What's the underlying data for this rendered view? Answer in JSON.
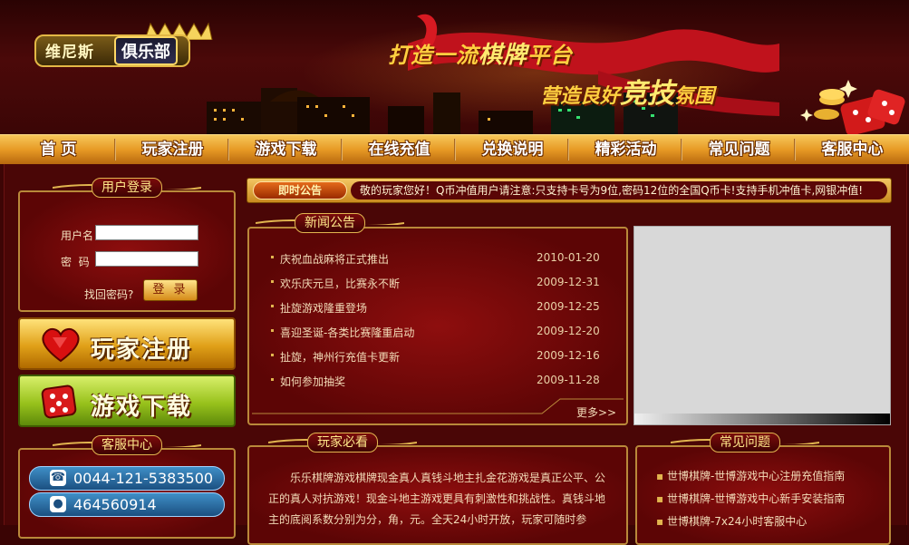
{
  "header": {
    "logo_part1": "维尼斯",
    "logo_part2": "俱乐部",
    "slogan1_a": "打造一流",
    "slogan1_b": "棋牌",
    "slogan1_c": "平台",
    "slogan2_a": "营造良好",
    "slogan2_b": "竞技",
    "slogan2_c": "氛围"
  },
  "nav": {
    "items": [
      "首 页",
      "玩家注册",
      "游戏下载",
      "在线充值",
      "兑换说明",
      "精彩活动",
      "常见问题",
      "客服中心"
    ]
  },
  "login": {
    "title": "用户登录",
    "username_label": "用户名",
    "password_label": "密  码",
    "forgot_label": "找回密码?",
    "login_button": "登 录"
  },
  "big_buttons": {
    "register": "玩家注册",
    "download": "游戏下载"
  },
  "service": {
    "title": "客服中心",
    "phone": "0044-121-5383500",
    "qq": "464560914"
  },
  "notice": {
    "tag": "即时公告",
    "message": "敬的玩家您好！Q币冲值用户请注意:只支持卡号为9位,密码12位的全国Q币卡!支持手机冲值卡,网银冲值!"
  },
  "news": {
    "title": "新闻公告",
    "items": [
      {
        "title": "庆祝血战麻将正式推出",
        "date": "2010-01-20"
      },
      {
        "title": "欢乐庆元旦，比赛永不断",
        "date": "2009-12-31"
      },
      {
        "title": "扯旋游戏隆重登场",
        "date": "2009-12-25"
      },
      {
        "title": "喜迎圣诞-各类比赛隆重启动",
        "date": "2009-12-20"
      },
      {
        "title": "扯旋，神州行充值卡更新",
        "date": "2009-12-16"
      },
      {
        "title": "如何参加抽奖",
        "date": "2009-11-28"
      }
    ],
    "more": "更多>>"
  },
  "must_read": {
    "title": "玩家必看",
    "text": "乐乐棋牌游戏棋牌现金真人真钱斗地主扎金花游戏是真正公平、公正的真人对抗游戏！现金斗地主游戏更具有刺激性和挑战性。真钱斗地主的底阅系数分别为分，角，元。全天24小时开放，玩家可随时参"
  },
  "faq": {
    "title": "常见问题",
    "items": [
      "世博棋牌-世博游戏中心注册充值指南",
      "世博棋牌-世博游戏中心新手安装指南",
      "世博棋牌-7x24小时客服中心"
    ]
  },
  "colors": {
    "background": "#3a0404",
    "gold": "#e2b54f",
    "nav_orange": "#e79a25",
    "panel_red": "#8e0e0e"
  }
}
